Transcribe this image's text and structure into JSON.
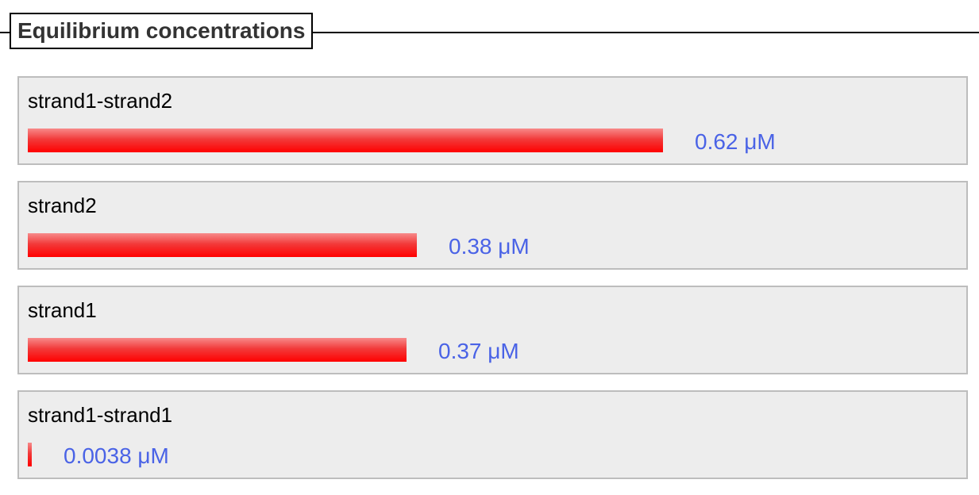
{
  "section": {
    "title": "Equilibrium concentrations"
  },
  "chart_data": {
    "type": "bar",
    "orientation": "horizontal",
    "title": "Equilibrium concentrations",
    "categories": [
      "strand1-strand2",
      "strand2",
      "strand1",
      "strand1-strand1"
    ],
    "values": [
      0.62,
      0.38,
      0.37,
      0.0038
    ],
    "value_labels": [
      "0.62 μM",
      "0.38 μM",
      "0.37 μM",
      "0.0038 μM"
    ],
    "unit": "μM",
    "bar_color": "#ff0000",
    "label_color": "#4a63e6",
    "xlim": [
      0,
      0.62
    ]
  }
}
